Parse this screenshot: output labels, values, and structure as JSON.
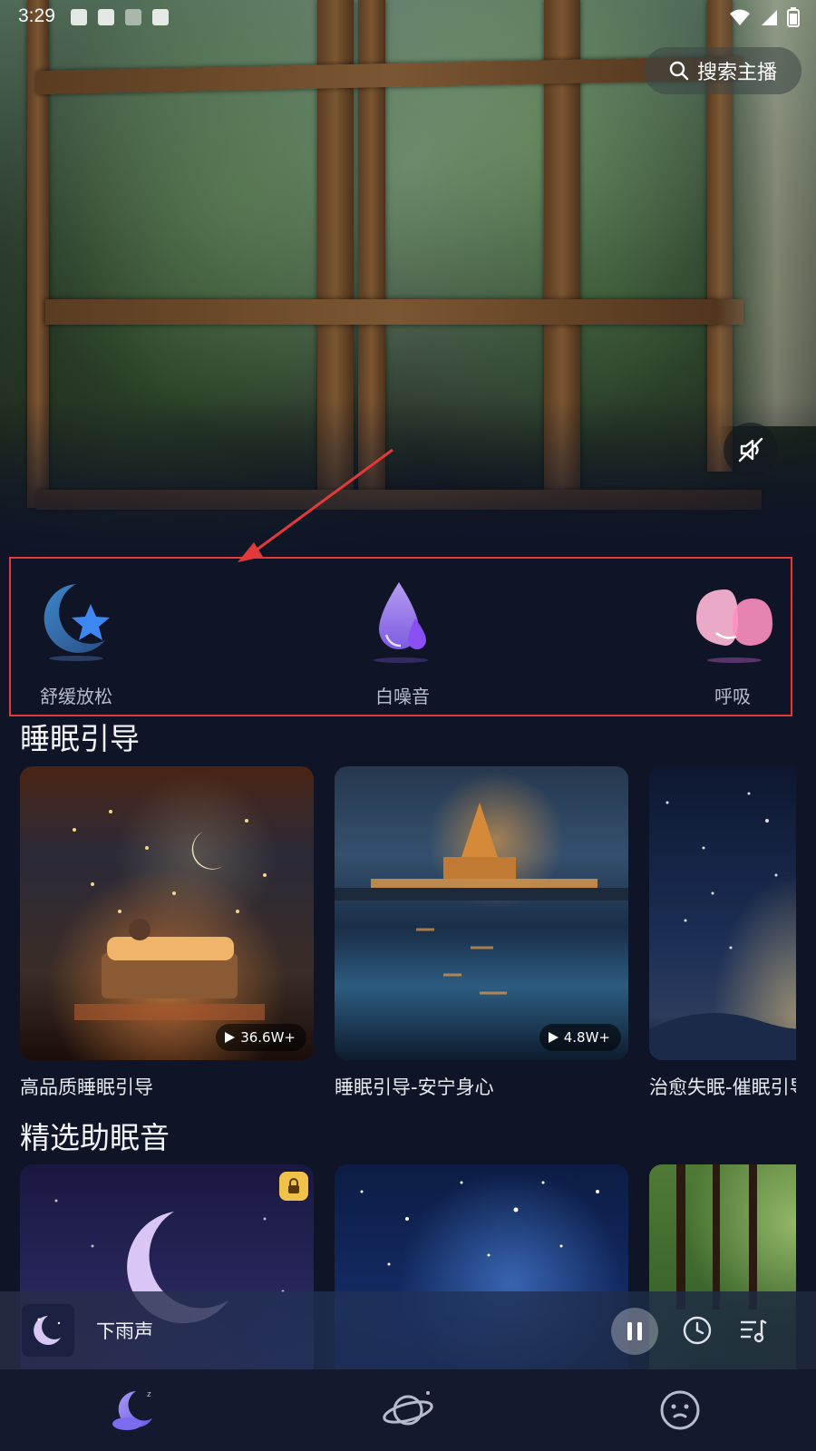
{
  "status_bar": {
    "time": "3:29"
  },
  "search": {
    "label": "搜索主播"
  },
  "categories": [
    {
      "label": "舒缓放松",
      "icon": "moon-star-icon"
    },
    {
      "label": "白噪音",
      "icon": "water-drop-icon"
    },
    {
      "label": "呼吸",
      "icon": "lungs-icon"
    }
  ],
  "sleep_guide": {
    "title": "睡眠引导",
    "cards": [
      {
        "title": "高品质睡眠引导",
        "plays": "36.6W+"
      },
      {
        "title": "睡眠引导-安宁身心",
        "plays": "4.8W+"
      },
      {
        "title": "治愈失眠-催眠引导"
      }
    ]
  },
  "featured_sounds": {
    "title": "精选助眠音",
    "cards": [
      {
        "locked": true
      },
      {
        "locked": false
      },
      {
        "locked": false
      }
    ]
  },
  "mini_player": {
    "title": "下雨声"
  },
  "bottom_nav": [
    {
      "icon": "sleep-moon-icon",
      "active": true
    },
    {
      "icon": "planet-icon",
      "active": false
    },
    {
      "icon": "face-icon",
      "active": false
    }
  ],
  "colors": {
    "background": "#0f1526",
    "annotation": "#e23a3a",
    "lock_badge": "#f0c24a",
    "nav_active": "#7b6cf0"
  }
}
